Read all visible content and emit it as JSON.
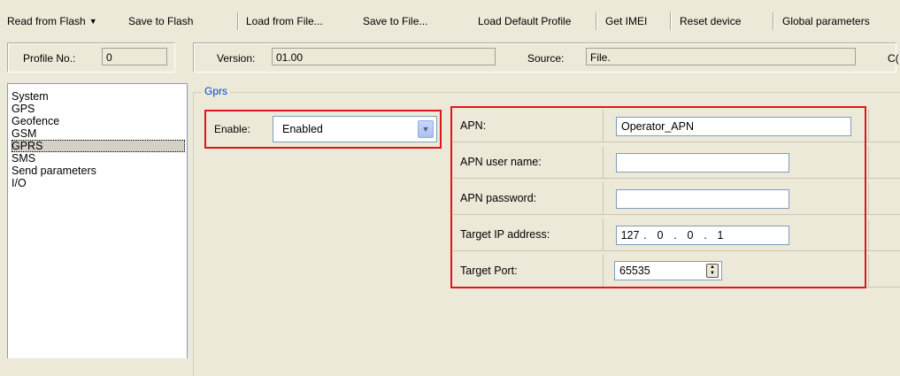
{
  "toolbar": {
    "read_from_flash": "Read from Flash",
    "save_to_flash": "Save to Flash",
    "load_from_file": "Load from File...",
    "save_to_file": "Save to File...",
    "load_default_profile": "Load Default Profile",
    "get_imei": "Get IMEI",
    "reset_device": "Reset device",
    "global_parameters": "Global parameters"
  },
  "info": {
    "profile_label": "Profile No.:",
    "profile_value": "0",
    "version_label": "Version:",
    "version_value": "01.00",
    "source_label": "Source:",
    "source_value": "File.",
    "cut_label": "C("
  },
  "nav": {
    "items": [
      "System",
      "GPS",
      "Geofence",
      "GSM",
      "GPRS",
      "SMS",
      "Send parameters",
      "I/O"
    ],
    "selected": "GPRS"
  },
  "group": {
    "title": "Gprs",
    "enable_label": "Enable:",
    "enable_value": "Enabled"
  },
  "params": {
    "apn_label": "APN:",
    "apn_value": "Operator_APN",
    "user_label": "APN user name:",
    "user_value": "",
    "password_label": "APN password:",
    "password_value": "",
    "ip_label": "Target IP address:",
    "ip": [
      "127",
      "0",
      "0",
      "1"
    ],
    "port_label": "Target Port:",
    "port_value": "65535"
  },
  "colors": {
    "highlight": "#e3141f",
    "group_title": "#0046d5",
    "window_bg": "#ece9d8"
  }
}
